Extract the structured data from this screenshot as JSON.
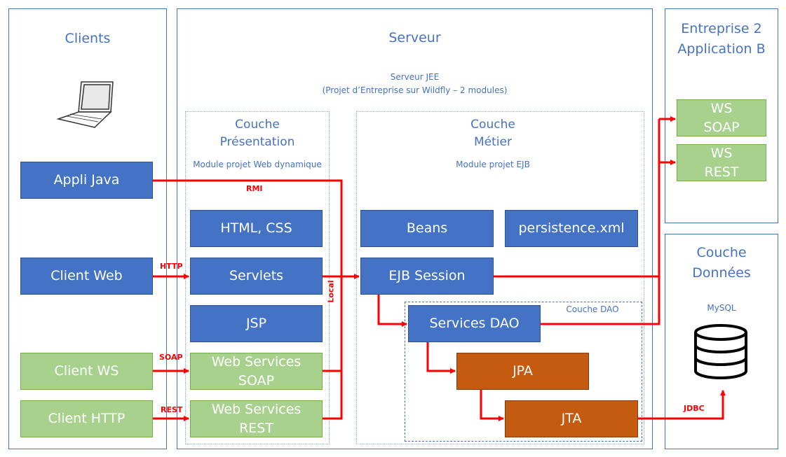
{
  "colors": {
    "primary": "#4472C4",
    "secondary": "#A9D18E",
    "accent": "#C55A11",
    "connector": "#FF0000"
  },
  "clients": {
    "title": "Clients",
    "icon": "laptop-icon",
    "items": [
      "Appli Java",
      "Client Web",
      "Client WS",
      "Client HTTP"
    ]
  },
  "serveur": {
    "title": "Serveur",
    "subtitle_line1": "Serveur JEE",
    "subtitle_line2": "(Projet d’Entreprise sur Wildfly – 2 modules)"
  },
  "presentation": {
    "title_line1": "Couche",
    "title_line2": "Présentation",
    "module": "Module projet Web dynamique",
    "items": [
      "HTML, CSS",
      "Servlets",
      "JSP",
      "Web Services SOAP",
      "Web Services REST"
    ]
  },
  "metier": {
    "title_line1": "Couche",
    "title_line2": "Métier",
    "module": "Module projet EJB",
    "beans": "Beans",
    "persistence": "persistence.xml",
    "ejb": "EJB Session"
  },
  "dao": {
    "title": "Couche DAO",
    "services": "Services DAO",
    "jpa": "JPA",
    "jta": "JTA"
  },
  "entreprise": {
    "title_line1": "Entreprise 2",
    "title_line2": "Application B",
    "ws_soap": "WS SOAP",
    "ws_rest": "WS REST"
  },
  "donnees": {
    "title_line1": "Couche",
    "title_line2": "Données",
    "db": "MySQL",
    "icon": "database-icon"
  },
  "connectors": {
    "rmi": "RMI",
    "http": "HTTP",
    "soap": "SOAP",
    "rest": "REST",
    "local": "Local",
    "jdbc": "JDBC"
  }
}
